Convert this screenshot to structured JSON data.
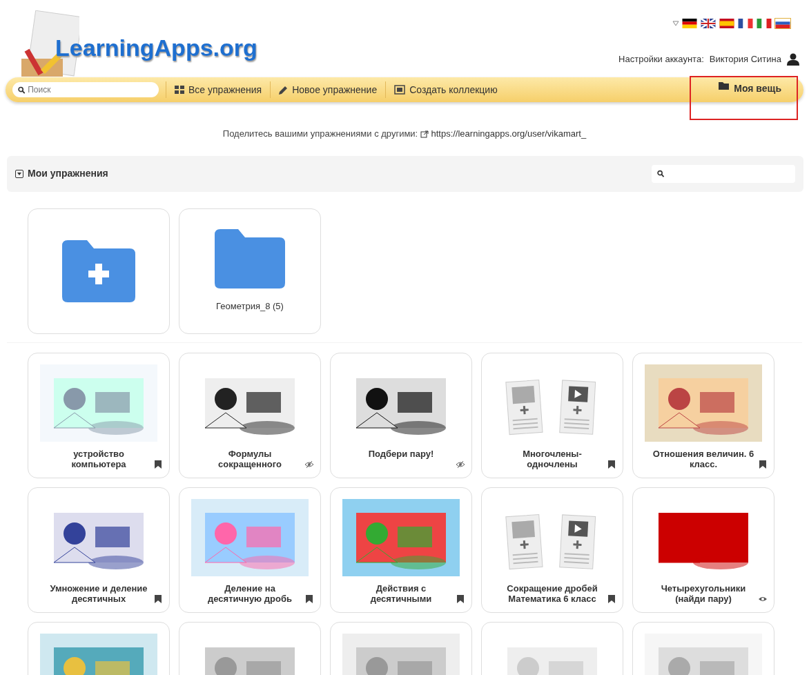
{
  "header": {
    "logo": "LearningApps.org",
    "flags": [
      {
        "kind": "de",
        "selected": false
      },
      {
        "kind": "gb",
        "selected": false
      },
      {
        "kind": "es",
        "selected": false
      },
      {
        "kind": "fr",
        "selected": false
      },
      {
        "kind": "it",
        "selected": false
      },
      {
        "kind": "ru",
        "selected": true
      }
    ],
    "account_label": "Настройки аккаунта:",
    "account_name": "Виктория Ситина"
  },
  "navbar": {
    "search_placeholder": "Поиск",
    "items": [
      {
        "kind": "grid",
        "label": "Все упражнения",
        "selected": false
      },
      {
        "kind": "pencil",
        "label": "Новое упражнение",
        "selected": false
      },
      {
        "kind": "collection",
        "label": "Создать коллекцию",
        "selected": false
      },
      {
        "kind": "folder",
        "label": "Моя вещь",
        "selected": true
      }
    ]
  },
  "share": {
    "text": "Поделитесь вашими упражнениями с другими:",
    "link": "https://learningapps.org/user/vikamart_"
  },
  "panel": {
    "title": "Мои упражнения",
    "expanded": true
  },
  "folders": [
    {
      "kind": "new"
    },
    {
      "kind": "folder",
      "label": "Геометрия_8 (5)"
    }
  ],
  "apps": [
    {
      "kind": "picture",
      "title": "устройство компьютера",
      "bookmarked": true
    },
    {
      "kind": "picture",
      "title": "Формулы сокращенного",
      "bookmarked": false,
      "hidden": true
    },
    {
      "kind": "picture",
      "title": "Подбери пару!",
      "bookmarked": false,
      "hidden": true
    },
    {
      "kind": "placeholder",
      "title": "Многочлены-одночлены",
      "bookmarked": true
    },
    {
      "kind": "picture",
      "title": "Отношения величин. 6 класс.",
      "bookmarked": true
    },
    {
      "kind": "picture",
      "title": "Умножение и деление десятичных",
      "bookmarked": true
    },
    {
      "kind": "picture",
      "title": "Деление на десятичную дробь",
      "bookmarked": true
    },
    {
      "kind": "picture",
      "title": "Действия с десятичными",
      "bookmarked": true
    },
    {
      "kind": "placeholder",
      "title": "Сокращение дробей Математика 6 класс",
      "bookmarked": true
    },
    {
      "kind": "picture",
      "title": "Четырехугольники (найди пару)",
      "bookmarked": false,
      "hidden": false
    },
    {
      "kind": "picture"
    },
    {
      "kind": "picture"
    },
    {
      "kind": "picture"
    },
    {
      "kind": "picture"
    },
    {
      "kind": "picture"
    }
  ]
}
